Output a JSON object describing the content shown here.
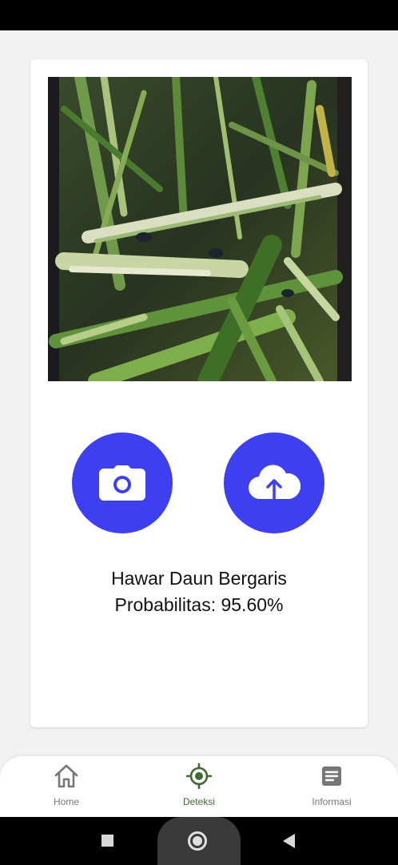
{
  "result": {
    "label": "Hawar Daun Bergaris",
    "probability_text": "Probabilitas: 95.60%"
  },
  "actions": {
    "camera_icon": "camera-icon",
    "upload_icon": "cloud-upload-icon",
    "button_color": "#3d3ff0"
  },
  "bottom_nav": {
    "items": [
      {
        "label": "Home",
        "icon": "home-icon",
        "active": false
      },
      {
        "label": "Deteksi",
        "icon": "target-icon",
        "active": true
      },
      {
        "label": "Informasi",
        "icon": "article-icon",
        "active": false
      }
    ],
    "active_color": "#3f6b33"
  },
  "system_nav": {
    "buttons": [
      "recent-apps",
      "home",
      "back"
    ]
  }
}
